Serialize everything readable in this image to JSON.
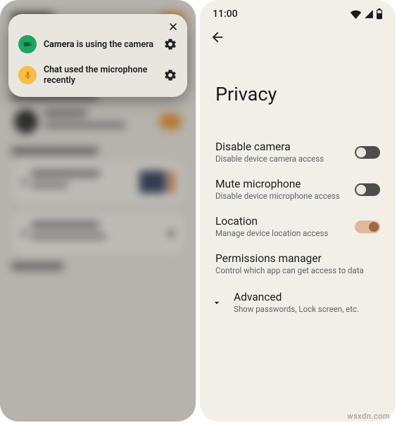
{
  "left": {
    "notif": {
      "camera_app": "Camera",
      "camera_msg": " is using the camera",
      "chat_app": "Chat",
      "chat_msg": " used the microphone recently"
    }
  },
  "right": {
    "status_time": "11:00",
    "page_title": "Privacy",
    "items": [
      {
        "title": "Disable camera",
        "sub": "Disable device camera access",
        "toggle": "off"
      },
      {
        "title": "Mute microphone",
        "sub": "Disable device microphone access",
        "toggle": "off"
      },
      {
        "title": "Location",
        "sub": "Manage device location access",
        "toggle": "on"
      },
      {
        "title": "Permissions manager",
        "sub": "Control which app can get access to data",
        "toggle": null
      }
    ],
    "advanced": {
      "title": "Advanced",
      "sub": "Show passwords, Lock screen, etc."
    }
  },
  "watermark": "wsxdn.com"
}
